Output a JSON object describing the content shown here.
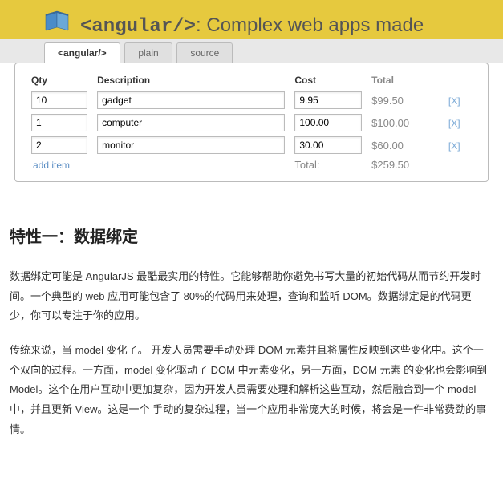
{
  "banner": {
    "tag": "<angular/>",
    "rest": ": Complex web apps made"
  },
  "tabs": [
    {
      "label": "<angular/>",
      "active": true
    },
    {
      "label": "plain",
      "active": false
    },
    {
      "label": "source",
      "active": false
    }
  ],
  "table": {
    "headers": {
      "qty": "Qty",
      "desc": "Description",
      "cost": "Cost",
      "total": "Total"
    },
    "rows": [
      {
        "qty": "10",
        "desc": "gadget",
        "cost": "9.95",
        "total": "$99.50",
        "x": "[X]"
      },
      {
        "qty": "1",
        "desc": "computer",
        "cost": "100.00",
        "total": "$100.00",
        "x": "[X]"
      },
      {
        "qty": "2",
        "desc": "monitor",
        "cost": "30.00",
        "total": "$60.00",
        "x": "[X]"
      }
    ],
    "add": "add item",
    "total_label": "Total:",
    "total_val": "$259.50"
  },
  "article": {
    "heading": "特性一：数据绑定",
    "p1": "数据绑定可能是 AngularJS 最酷最实用的特性。它能够帮助你避免书写大量的初始代码从而节约开发时间。一个典型的 web 应用可能包含了 80%的代码用来处理，查询和监听 DOM。数据绑定是的代码更少，你可以专注于你的应用。",
    "p2": "传统来说，当 model 变化了。 开发人员需要手动处理 DOM 元素并且将属性反映到这些变化中。这个一个双向的过程。一方面，model 变化驱动了 DOM 中元素变化，另一方面，DOM 元素  的变化也会影响到 Model。这个在用户互动中更加复杂，因为开发人员需要处理和解析这些互动，然后融合到一个 model 中，并且更新 View。这是一个 手动的复杂过程，当一个应用非常庞大的时候，将会是一件非常费劲的事情。"
  }
}
